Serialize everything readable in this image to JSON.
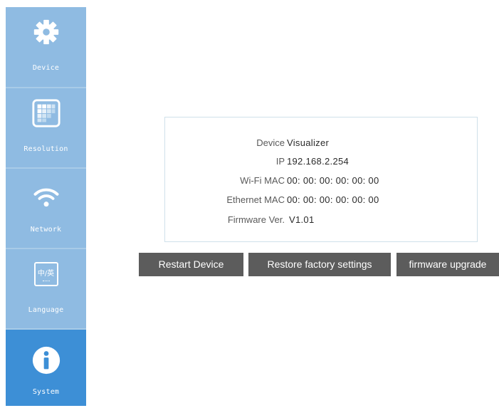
{
  "sidebar": {
    "items": [
      {
        "label": "Device",
        "icon": "gear-icon"
      },
      {
        "label": "Resolution",
        "icon": "resolution-grid-icon"
      },
      {
        "label": "Network",
        "icon": "wifi-icon"
      },
      {
        "label": "Language",
        "icon": "language-icon",
        "icon_text": "中/英"
      },
      {
        "label": "System",
        "icon": "info-icon",
        "active": true
      }
    ],
    "colors": {
      "item": "#8fbbe2",
      "active": "#3d8fd6"
    }
  },
  "info": {
    "rows": [
      {
        "label": "Device",
        "value": "Visualizer"
      },
      {
        "label": "IP",
        "value": "192.168.2.254"
      },
      {
        "label": "Wi-Fi MAC",
        "value": "00: 00: 00: 00: 00: 00"
      },
      {
        "label": "Ethernet MAC",
        "value": "00: 00: 00: 00: 00: 00"
      },
      {
        "label": "Firmware Ver.",
        "value": "V1.01"
      }
    ]
  },
  "actions": {
    "restart": "Restart Device",
    "restore": "Restore factory settings",
    "upgrade": "firmware upgrade"
  }
}
